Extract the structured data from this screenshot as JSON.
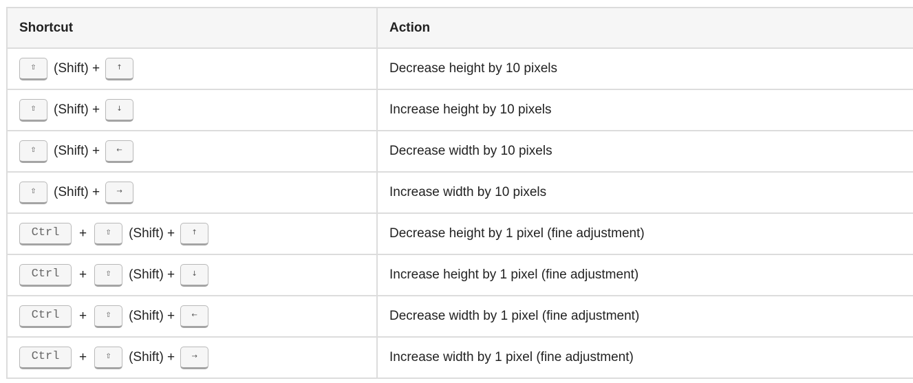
{
  "table": {
    "headers": [
      "Shortcut",
      "Action"
    ],
    "shift_label": "(Shift) +",
    "plus": "+",
    "rows": [
      {
        "keys": {
          "ctrl": null,
          "shift": "⇧",
          "arrow": "↑"
        },
        "action": "Decrease height by 10 pixels"
      },
      {
        "keys": {
          "ctrl": null,
          "shift": "⇧",
          "arrow": "↓"
        },
        "action": "Increase height by 10 pixels"
      },
      {
        "keys": {
          "ctrl": null,
          "shift": "⇧",
          "arrow": "←"
        },
        "action": "Decrease width by 10 pixels"
      },
      {
        "keys": {
          "ctrl": null,
          "shift": "⇧",
          "arrow": "→"
        },
        "action": "Increase width by 10 pixels"
      },
      {
        "keys": {
          "ctrl": "Ctrl",
          "shift": "⇧",
          "arrow": "↑"
        },
        "action": "Decrease height by 1 pixel (fine adjustment)"
      },
      {
        "keys": {
          "ctrl": "Ctrl",
          "shift": "⇧",
          "arrow": "↓"
        },
        "action": "Increase height by 1 pixel (fine adjustment)"
      },
      {
        "keys": {
          "ctrl": "Ctrl",
          "shift": "⇧",
          "arrow": "←"
        },
        "action": "Decrease width by 1 pixel (fine adjustment)"
      },
      {
        "keys": {
          "ctrl": "Ctrl",
          "shift": "⇧",
          "arrow": "→"
        },
        "action": "Increase width by 1 pixel (fine adjustment)"
      }
    ]
  }
}
